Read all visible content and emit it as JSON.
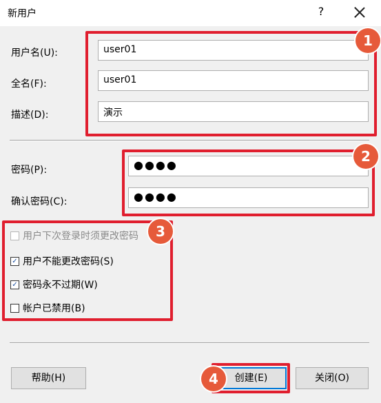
{
  "window": {
    "title": "新用户",
    "help_glyph": "?"
  },
  "fields": {
    "username": {
      "label": "用户名(U):",
      "value": "user01"
    },
    "fullname": {
      "label": "全名(F):",
      "value": "user01"
    },
    "description": {
      "label": "描述(D):",
      "value": "演示"
    },
    "password": {
      "label": "密码(P):",
      "value": "●●●●"
    },
    "confirm": {
      "label": "确认密码(C):",
      "value": "●●●●"
    }
  },
  "options": {
    "must_change": {
      "label": "用户下次登录时须更改密码",
      "checked": false,
      "disabled": true
    },
    "cannot_change": {
      "label": "用户不能更改密码(S)",
      "checked": true
    },
    "never_expires": {
      "label": "密码永不过期(W)",
      "checked": true
    },
    "disabled_account": {
      "label": "帐户已禁用(B)",
      "checked": false
    }
  },
  "buttons": {
    "help": "帮助(H)",
    "create": "创建(E)",
    "close": "关闭(O)"
  },
  "annotations": {
    "b1": "1",
    "b2": "2",
    "b3": "3",
    "b4": "4"
  },
  "colors": {
    "highlight": "#e01e2e",
    "badge": "#e65a3a"
  }
}
